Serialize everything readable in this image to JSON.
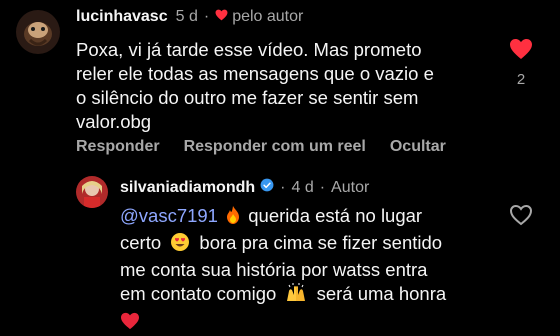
{
  "comment1": {
    "username": "lucinhavasc",
    "time": "5 d",
    "liked_by_author_label": "pelo autor",
    "lines": [
      "Poxa, vi já tarde esse vídeo. Mas prometo",
      "reler ele todas as mensagens que o vazio e",
      "o silêncio do outro me fazer se sentir sem",
      "valor.obg"
    ],
    "like_count": "2",
    "actions": {
      "reply": "Responder",
      "reply_reel": "Responder com um reel",
      "hide": "Ocultar"
    }
  },
  "reply1": {
    "username": "silvaniadiamondh",
    "time": "4 d",
    "author_label": "Autor",
    "mention": "@vasc7191",
    "text_1": "querida está no lugar",
    "text_2a": "certo",
    "text_2b": "bora pra cima se fizer sentido",
    "text_3": "me conta sua história por watss entra",
    "text_4a": "em contato comigo",
    "text_4b": "será uma honra"
  },
  "colors": {
    "background": "#000000",
    "text": "#f5f5f5",
    "muted": "#a8a8a8",
    "like_red": "#ff3040",
    "mention": "#8ea7ff"
  }
}
